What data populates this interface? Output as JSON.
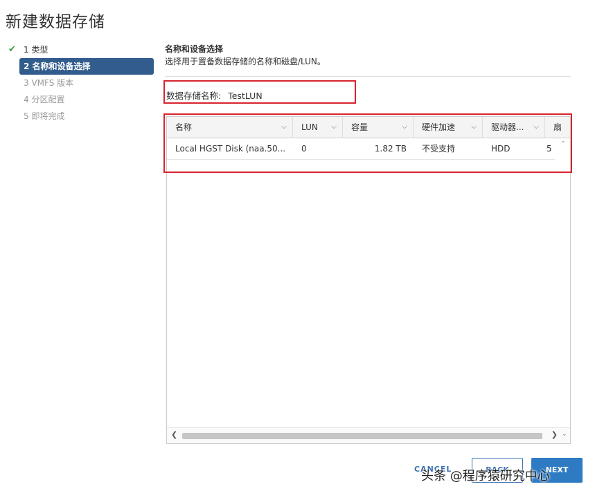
{
  "window": {
    "title": "新建数据存储"
  },
  "steps": [
    {
      "label": "1 类型",
      "state": "done"
    },
    {
      "label": "2 名称和设备选择",
      "state": "active"
    },
    {
      "label": "3 VMFS 版本",
      "state": "pending"
    },
    {
      "label": "4 分区配置",
      "state": "pending"
    },
    {
      "label": "5 即将完成",
      "state": "pending"
    }
  ],
  "section": {
    "title": "名称和设备选择",
    "description": "选择用于置备数据存储的名称和磁盘/LUN。"
  },
  "datastore_name": {
    "label": "数据存储名称:",
    "value": "TestLUN"
  },
  "table": {
    "columns": [
      "名称",
      "LUN",
      "容量",
      "硬件加速",
      "驱动器...",
      "扇"
    ],
    "rows": [
      [
        "Local HGST Disk (naa.50...",
        "0",
        "1.82 TB",
        "不受支持",
        "HDD",
        "5"
      ]
    ]
  },
  "footer": {
    "cancel_label": "CANCEL",
    "back_label": "BACK",
    "next_label": "NEXT"
  },
  "watermark": "头条 @程序猿研究中心",
  "colors": {
    "accent": "#315c8c",
    "highlight": "#d9232d",
    "primary_button": "#2e7bc4",
    "check": "#3c9a3c"
  },
  "icons": {
    "done": "check-icon",
    "sort": "chevron-down-icon"
  }
}
